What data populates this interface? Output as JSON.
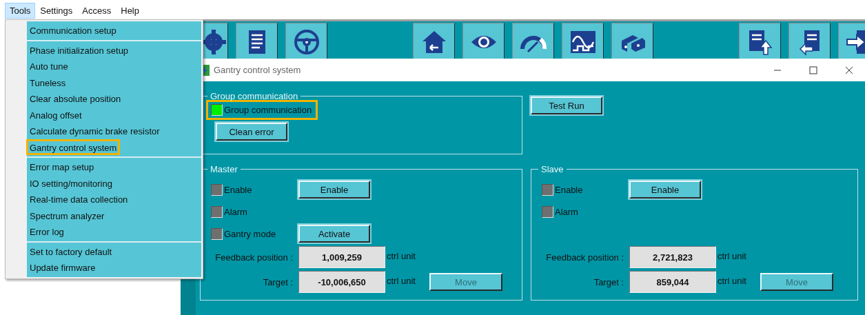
{
  "menubar": [
    {
      "label": "Tools",
      "selected": true
    },
    {
      "label": "Settings",
      "selected": false
    },
    {
      "label": "Access",
      "selected": false
    },
    {
      "label": "Help",
      "selected": false
    }
  ],
  "menu": {
    "groups": [
      {
        "items": [
          {
            "label": "Communication setup",
            "highlighted": false
          }
        ]
      },
      {
        "items": [
          {
            "label": "Phase initialization setup",
            "highlighted": false
          },
          {
            "label": "Auto tune",
            "highlighted": false
          },
          {
            "label": "Tuneless",
            "highlighted": false
          },
          {
            "label": "Clear absolute position",
            "highlighted": false
          },
          {
            "label": "Analog offset",
            "highlighted": false
          },
          {
            "label": "Calculate dynamic brake resistor",
            "highlighted": false
          },
          {
            "label": "Gantry control system",
            "highlighted": true
          }
        ]
      },
      {
        "items": [
          {
            "label": "Error map setup",
            "highlighted": false
          },
          {
            "label": "IO setting/monitoring",
            "highlighted": false
          },
          {
            "label": "Real-time data collection",
            "highlighted": false
          },
          {
            "label": "Spectrum analyzer",
            "highlighted": false
          },
          {
            "label": "Error log",
            "highlighted": false
          }
        ]
      },
      {
        "items": [
          {
            "label": "Set to factory default",
            "highlighted": false
          },
          {
            "label": "Update firmware",
            "highlighted": false
          }
        ]
      }
    ]
  },
  "dialog": {
    "title": "Gantry control system",
    "group": {
      "legend": "Group communication",
      "indicator": {
        "label": "Group communication",
        "on": true,
        "highlighted": true
      },
      "button": {
        "label": "Clean error",
        "disabled": false
      }
    },
    "test_button": {
      "label": "Test Run",
      "disabled": false
    },
    "axes": [
      {
        "legend": "Master",
        "indicators": [
          {
            "label": "Enable",
            "on": false,
            "button": {
              "label": "Enable",
              "disabled": false
            }
          },
          {
            "label": "Alarm",
            "on": false
          },
          {
            "label": "Gantry mode",
            "on": false,
            "button": {
              "label": "Activate",
              "disabled": false
            }
          }
        ],
        "fields": [
          {
            "label": "Feedback position :",
            "value": "1,009,259",
            "unit": "ctrl unit"
          },
          {
            "label": "Target :",
            "value": "-10,006,650",
            "unit": "ctrl unit",
            "button": {
              "label": "Move",
              "disabled": true
            }
          }
        ]
      },
      {
        "legend": "Slave",
        "indicators": [
          {
            "label": "Enable",
            "on": false,
            "button": {
              "label": "Enable",
              "disabled": false
            }
          },
          {
            "label": "Alarm",
            "on": false
          }
        ],
        "fields": [
          {
            "label": "Feedback position :",
            "value": "2,721,823",
            "unit": "ctrl unit"
          },
          {
            "label": "Target :",
            "value": "859,044",
            "unit": "ctrl unit",
            "button": {
              "label": "Move",
              "disabled": true
            }
          }
        ]
      }
    ]
  }
}
